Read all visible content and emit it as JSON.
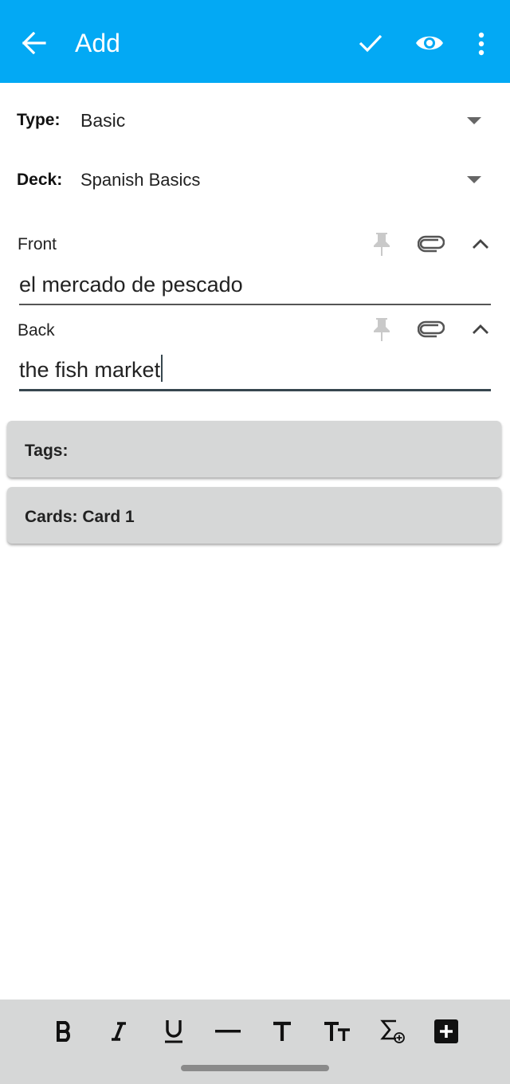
{
  "app_bar": {
    "title": "Add",
    "icons": [
      "arrow-back-icon",
      "check-icon",
      "eye-icon",
      "more-vert-icon"
    ],
    "color": "#03a9f4"
  },
  "note_type": {
    "label": "Type:",
    "value": "Basic"
  },
  "deck": {
    "label": "Deck:",
    "value": "Spanish Basics"
  },
  "fields": [
    {
      "label": "Front",
      "value": "el mercado de pescado"
    },
    {
      "label": "Back",
      "value": "the fish market"
    }
  ],
  "tags": {
    "label": "Tags:"
  },
  "cards": {
    "label": "Cards: Card 1"
  },
  "toolbar": {
    "buttons": [
      "bold-icon",
      "italic-icon",
      "underline-icon",
      "horizontal-rule-icon",
      "text-size-icon",
      "font-size-icon",
      "mathjax-icon",
      "add-custom-button-icon"
    ]
  }
}
